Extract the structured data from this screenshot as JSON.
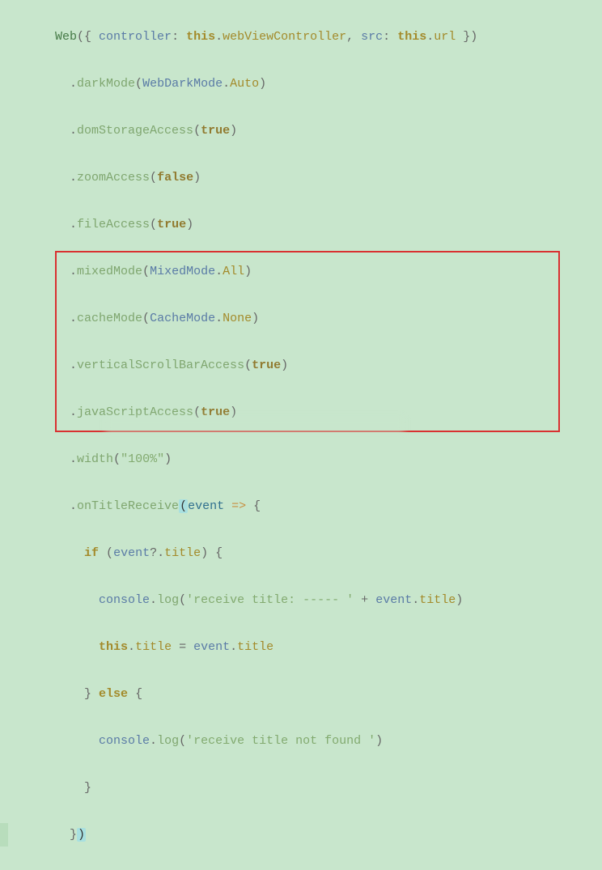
{
  "code": {
    "l1_web": "Web",
    "l1_controller_key": "controller",
    "l1_this": "this",
    "l1_webview": "webViewController",
    "l1_src_key": "src",
    "l1_url": "url",
    "l2_dark": "darkMode",
    "l2_webdark": "WebDarkMode",
    "l2_auto": "Auto",
    "l3_dom": "domStorageAccess",
    "true": "true",
    "false": "false",
    "l4_zoom": "zoomAccess",
    "l5_file": "fileAccess",
    "l6_mixed": "mixedMode",
    "l6_type": "MixedMode",
    "l6_all": "All",
    "l7_cache": "cacheMode",
    "l7_type": "CacheMode",
    "l7_none": "None",
    "l8_vscroll": "verticalScrollBarAccess",
    "l9_js": "javaScriptAccess",
    "l10_width": "width",
    "l10_val": "\"100%\"",
    "l11_onTitle": "onTitleReceive",
    "l11_event": "event",
    "l12_if": "if",
    "l12_event": "event",
    "l12_title": "title",
    "l13_console": "console",
    "l13_log": "log",
    "l13_str": "'receive title: ----- '",
    "l13_event": "event",
    "l13_title": "title",
    "l14_this": "this",
    "l14_title": "title",
    "l14_event": "event",
    "l15_else": "else",
    "l16_console": "console",
    "l16_log": "log",
    "l16_str": "'receive title not found '",
    "arrow": "=>",
    "plus": "+",
    "eq": "="
  }
}
